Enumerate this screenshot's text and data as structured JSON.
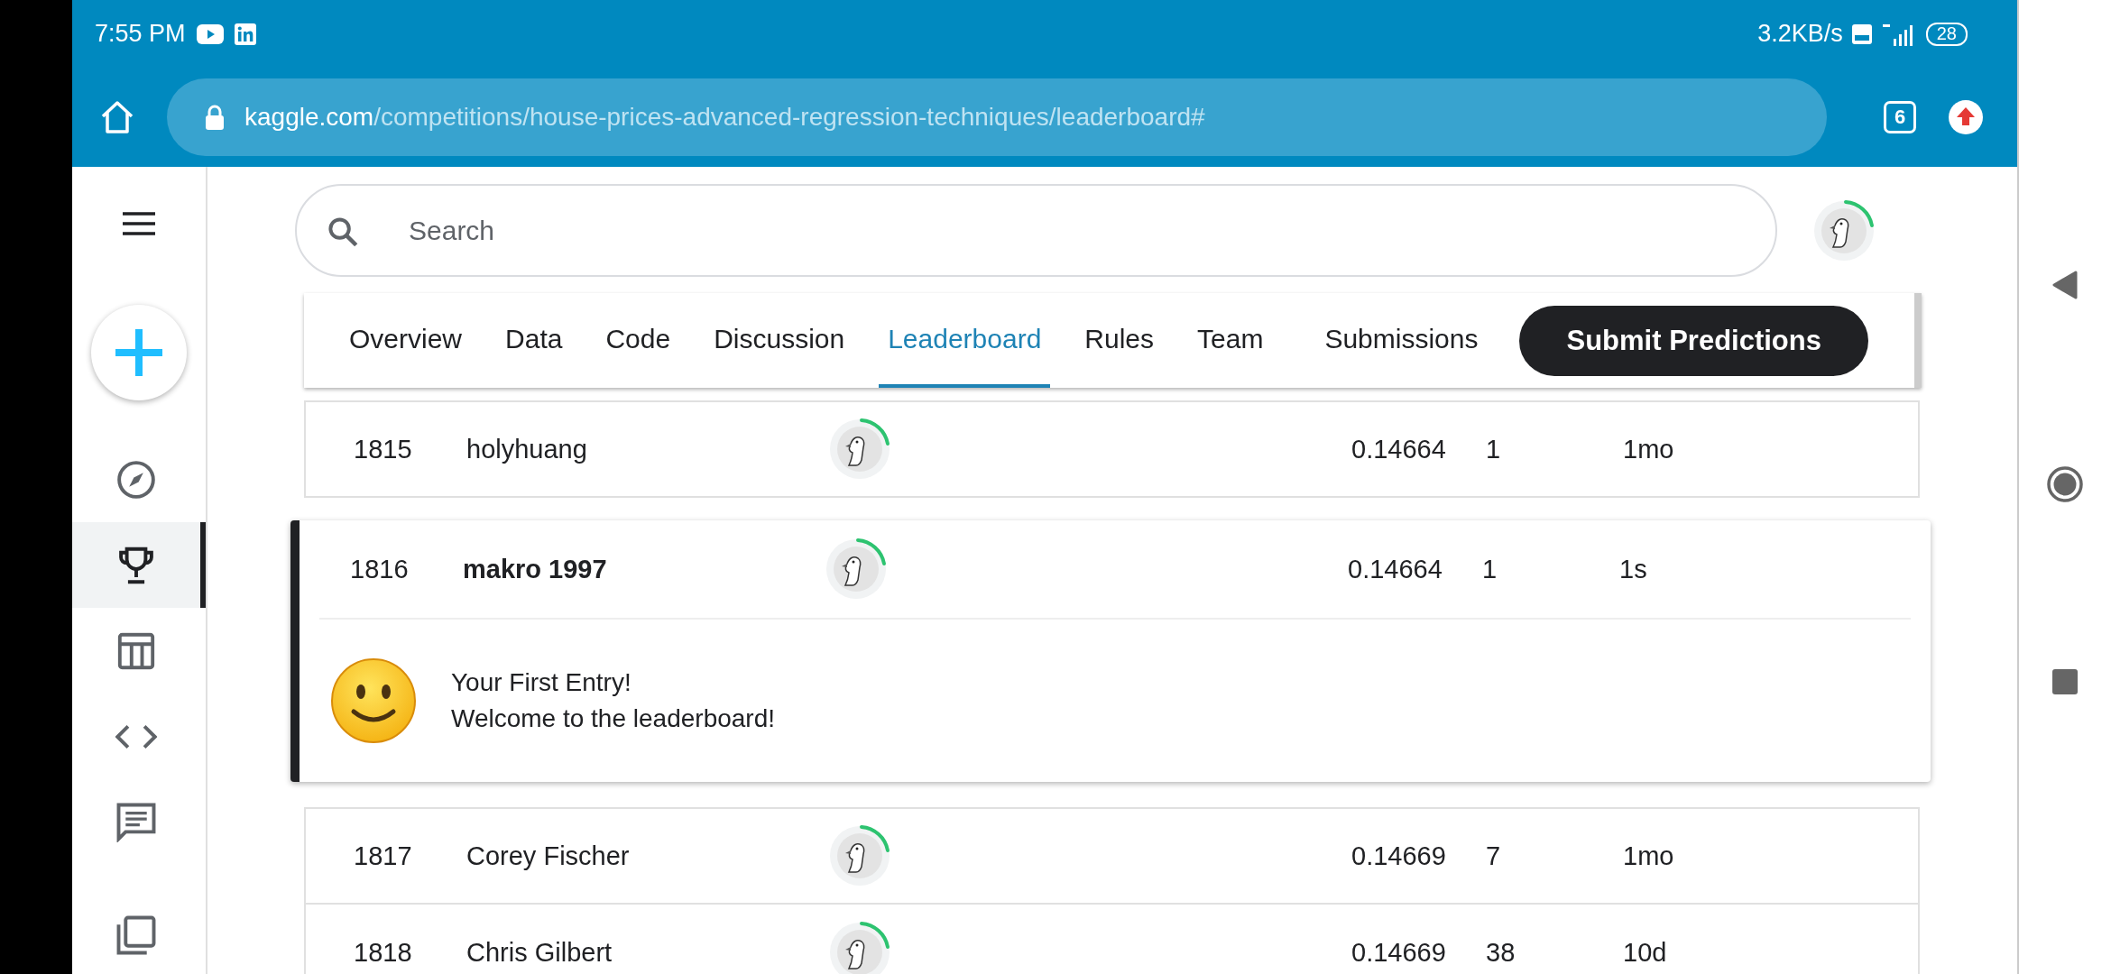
{
  "status_bar": {
    "time": "7:55 PM",
    "net_speed": "3.2KB/s",
    "battery": "28"
  },
  "browser": {
    "url_host": "kaggle.com",
    "url_path": "/competitions/house-prices-advanced-regression-techniques/leaderboard#",
    "tab_count": "6"
  },
  "sidebar": {
    "items": [
      {
        "kind": "compass",
        "selected": false
      },
      {
        "kind": "trophy",
        "selected": true
      },
      {
        "kind": "table",
        "selected": false
      },
      {
        "kind": "code",
        "selected": false
      },
      {
        "kind": "comment",
        "selected": false
      },
      {
        "kind": "copy",
        "selected": false
      }
    ]
  },
  "search": {
    "placeholder": "Search"
  },
  "tabs": [
    {
      "label": "Overview",
      "selected": false
    },
    {
      "label": "Data",
      "selected": false
    },
    {
      "label": "Code",
      "selected": false
    },
    {
      "label": "Discussion",
      "selected": false
    },
    {
      "label": "Leaderboard",
      "selected": true
    },
    {
      "label": "Rules",
      "selected": false
    },
    {
      "label": "Team",
      "selected": false
    },
    {
      "label": "Submissions",
      "selected": false
    }
  ],
  "submit_button": "Submit Predictions",
  "leaderboard": {
    "rows": [
      {
        "rank": "1815",
        "name": "holyhuang",
        "score": "0.14664",
        "entries": "1",
        "last": "1mo",
        "own": false
      },
      {
        "rank": "1816",
        "name": "makro 1997",
        "score": "0.14664",
        "entries": "1",
        "last": "1s",
        "own": true,
        "message": {
          "title": "Your First Entry!",
          "text": "Welcome to the leaderboard!"
        }
      },
      {
        "rank": "1817",
        "name": "Corey Fischer",
        "score": "0.14669",
        "entries": "7",
        "last": "1mo",
        "own": false
      },
      {
        "rank": "1818",
        "name": "Chris Gilbert",
        "score": "0.14669",
        "entries": "38",
        "last": "10d",
        "own": false
      }
    ]
  }
}
